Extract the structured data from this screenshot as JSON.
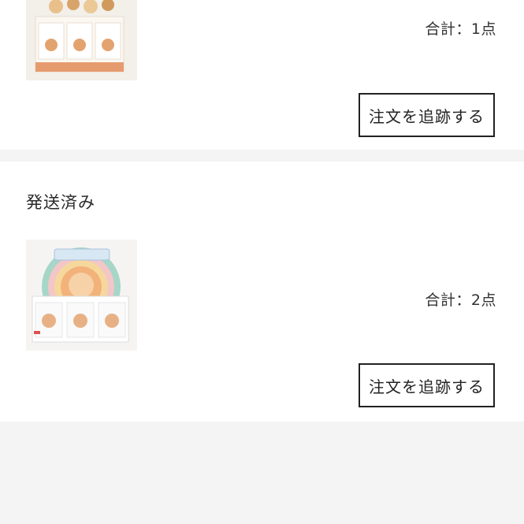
{
  "orders": [
    {
      "status": "",
      "product_image": "blind-box-set-cream",
      "total_label": "合計：1点",
      "track_button": "注文を追跡する"
    },
    {
      "status": "発送済み",
      "product_image": "blind-box-set-rainbow",
      "total_label": "合計：2点",
      "track_button": "注文を追跡する"
    }
  ],
  "colors": {
    "page_background": "#f4f4f4",
    "card_background": "#ffffff",
    "button_border": "#222222"
  }
}
